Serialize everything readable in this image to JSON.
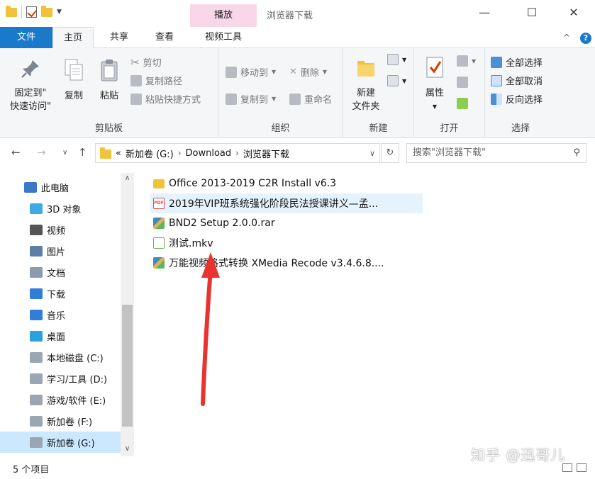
{
  "title_bar": {
    "context_tab": "播放",
    "window_title": "浏览器下载",
    "minimize": "—",
    "maximize": "☐",
    "close": "✕"
  },
  "ribbon_tabs": {
    "file": "文件",
    "home": "主页",
    "share": "共享",
    "view": "查看",
    "video_tools": "视频工具",
    "collapse": "^",
    "help": "?"
  },
  "clipboard": {
    "pin": "固定到\"",
    "pin_line2": "快速访问\"",
    "copy": "复制",
    "paste": "粘贴",
    "cut": "剪切",
    "copy_path": "复制路径",
    "paste_shortcut": "粘贴快捷方式",
    "label": "剪贴板"
  },
  "organize": {
    "move_to": "移动到",
    "copy_to": "复制到",
    "delete": "删除",
    "rename": "重命名",
    "label": "组织"
  },
  "new_group": {
    "new_folder": "新建",
    "new_folder_line2": "文件夹",
    "label": "新建"
  },
  "open_group": {
    "properties": "属性",
    "label": "打开"
  },
  "select_group": {
    "select_all": "全部选择",
    "select_none": "全部取消",
    "invert": "反向选择",
    "label": "选择"
  },
  "address": {
    "prefix": "«",
    "crumbs": [
      "新加卷 (G:)",
      "Download",
      "浏览器下载"
    ],
    "search_placeholder": "搜索\"浏览器下载\""
  },
  "nav_pane": {
    "items": [
      {
        "label": "此电脑",
        "color": "#3a78c9"
      },
      {
        "label": "3D 对象",
        "color": "#3fa9e6"
      },
      {
        "label": "视频",
        "color": "#555555"
      },
      {
        "label": "图片",
        "color": "#5b7fa8"
      },
      {
        "label": "文档",
        "color": "#8a9bb0"
      },
      {
        "label": "下载",
        "color": "#2f7fd8"
      },
      {
        "label": "音乐",
        "color": "#2f7fd8"
      },
      {
        "label": "桌面",
        "color": "#2aa0e0"
      },
      {
        "label": "本地磁盘 (C:)",
        "color": "#9aa6b2"
      },
      {
        "label": "学习/工具 (D:)",
        "color": "#9aa6b2"
      },
      {
        "label": "游戏/软件 (E:)",
        "color": "#9aa6b2"
      },
      {
        "label": "新加卷 (F:)",
        "color": "#9aa6b2"
      },
      {
        "label": "新加卷 (G:)",
        "color": "#9aa6b2"
      }
    ]
  },
  "files": [
    {
      "name": "Office 2013-2019 C2R Install v6.3",
      "type": "folder"
    },
    {
      "name": "2019年VIP班系统强化阶段民法授课讲义—孟...",
      "type": "pdf"
    },
    {
      "name": "BND2 Setup 2.0.0.rar",
      "type": "rar"
    },
    {
      "name": "测试.mkv",
      "type": "video"
    },
    {
      "name": "万能视频格式转换 XMedia Recode v3.4.6.8....",
      "type": "rar"
    }
  ],
  "pdf_badge": "PDF",
  "status": {
    "count": "5 个项目"
  },
  "watermark": "知乎 @迅哥儿",
  "annotation_color": "#e8332e"
}
